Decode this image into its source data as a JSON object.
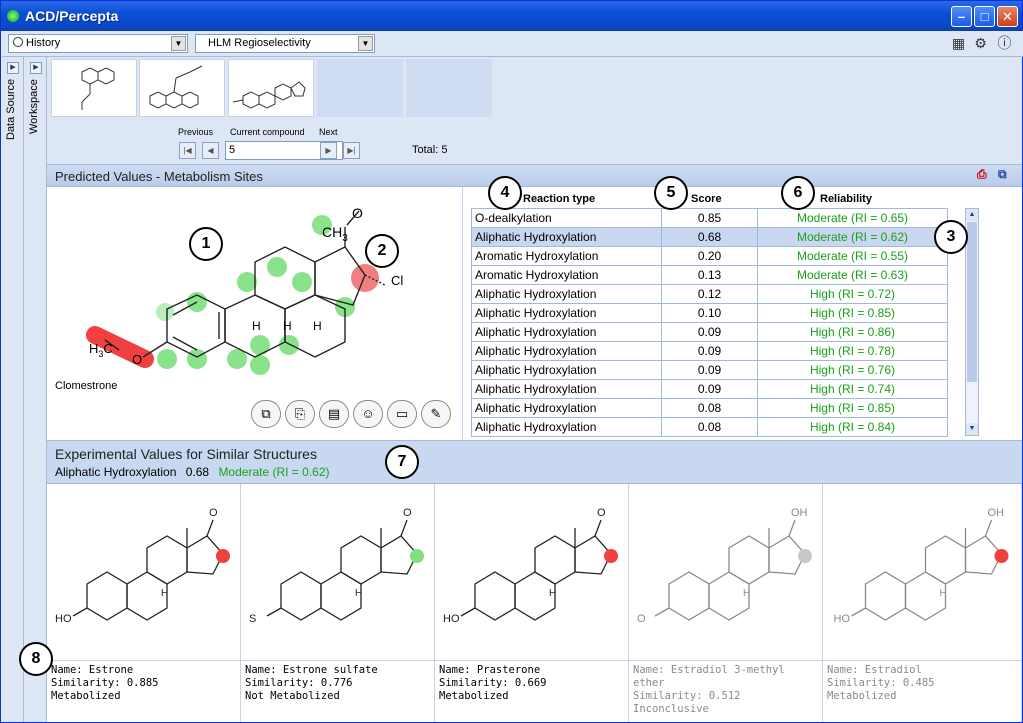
{
  "window": {
    "title": "ACD/Percepta"
  },
  "toolbar": {
    "history": "History",
    "module": "HLM Regioselectivity"
  },
  "side": {
    "data_source": "Data Source",
    "workspace": "Workspace"
  },
  "navigator": {
    "previous": "Previous",
    "current": "Current compound",
    "next": "Next",
    "current_value": "5",
    "total": "Total: 5"
  },
  "predicted": {
    "title": "Predicted Values - Metabolism Sites",
    "compound_name": "Clomestrone",
    "columns": {
      "reaction": "Reaction type",
      "score": "Score",
      "reliability": "Reliability"
    },
    "rows": [
      {
        "reaction": "O-dealkylation",
        "score": "0.85",
        "reliability": "Moderate (RI = 0.65)"
      },
      {
        "reaction": "Aliphatic Hydroxylation",
        "score": "0.68",
        "reliability": "Moderate (RI = 0.62)"
      },
      {
        "reaction": "Aromatic Hydroxylation",
        "score": "0.20",
        "reliability": "Moderate (RI = 0.55)"
      },
      {
        "reaction": "Aromatic Hydroxylation",
        "score": "0.13",
        "reliability": "Moderate (RI = 0.63)"
      },
      {
        "reaction": "Aliphatic Hydroxylation",
        "score": "0.12",
        "reliability": "High (RI = 0.72)"
      },
      {
        "reaction": "Aliphatic Hydroxylation",
        "score": "0.10",
        "reliability": "High (RI = 0.85)"
      },
      {
        "reaction": "Aliphatic Hydroxylation",
        "score": "0.09",
        "reliability": "High (RI = 0.86)"
      },
      {
        "reaction": "Aliphatic Hydroxylation",
        "score": "0.09",
        "reliability": "High (RI = 0.78)"
      },
      {
        "reaction": "Aliphatic Hydroxylation",
        "score": "0.09",
        "reliability": "High (RI = 0.76)"
      },
      {
        "reaction": "Aliphatic Hydroxylation",
        "score": "0.09",
        "reliability": "High (RI = 0.74)"
      },
      {
        "reaction": "Aliphatic Hydroxylation",
        "score": "0.08",
        "reliability": "High (RI = 0.85)"
      },
      {
        "reaction": "Aliphatic Hydroxylation",
        "score": "0.08",
        "reliability": "High (RI = 0.84)"
      }
    ]
  },
  "experimental": {
    "title": "Experimental Values for Similar Structures",
    "selected_reaction": "Aliphatic Hydroxylation",
    "selected_score": "0.68",
    "selected_reliability": "Moderate (RI = 0.62)",
    "structures": [
      {
        "name": "Name: Estrone",
        "similarity": "Similarity: 0.885",
        "status": "Metabolized"
      },
      {
        "name": "Name: Estrone sulfate",
        "similarity": "Similarity: 0.776",
        "status": "Not Metabolized"
      },
      {
        "name": "Name: Prasterone",
        "similarity": "Similarity: 0.669",
        "status": "Metabolized"
      },
      {
        "name": "Name: Estradiol 3-methyl ether",
        "similarity": "Similarity: 0.512",
        "status": "Inconclusive"
      },
      {
        "name": "Name: Estradiol",
        "similarity": "Similarity: 0.485",
        "status": "Metabolized"
      }
    ]
  },
  "molecule": {
    "ch3": "CH",
    "ch3_sub": "3",
    "h3": "H",
    "h3_sub": "3",
    "c": "C",
    "o": "O",
    "cl": "Cl",
    "ring_o": "O",
    "h": "H"
  },
  "structure_labels": {
    "ho": "HO",
    "o": "O",
    "oh": "OH",
    "h": "H",
    "s": "S",
    "me": "O"
  },
  "markers": [
    "1",
    "2",
    "3",
    "4",
    "5",
    "6",
    "7",
    "8"
  ],
  "colors": {
    "accent_green": "#1aa01a",
    "site_green": "#7ee07e",
    "site_red": "#f04040",
    "selection": "#c8d6f0"
  }
}
